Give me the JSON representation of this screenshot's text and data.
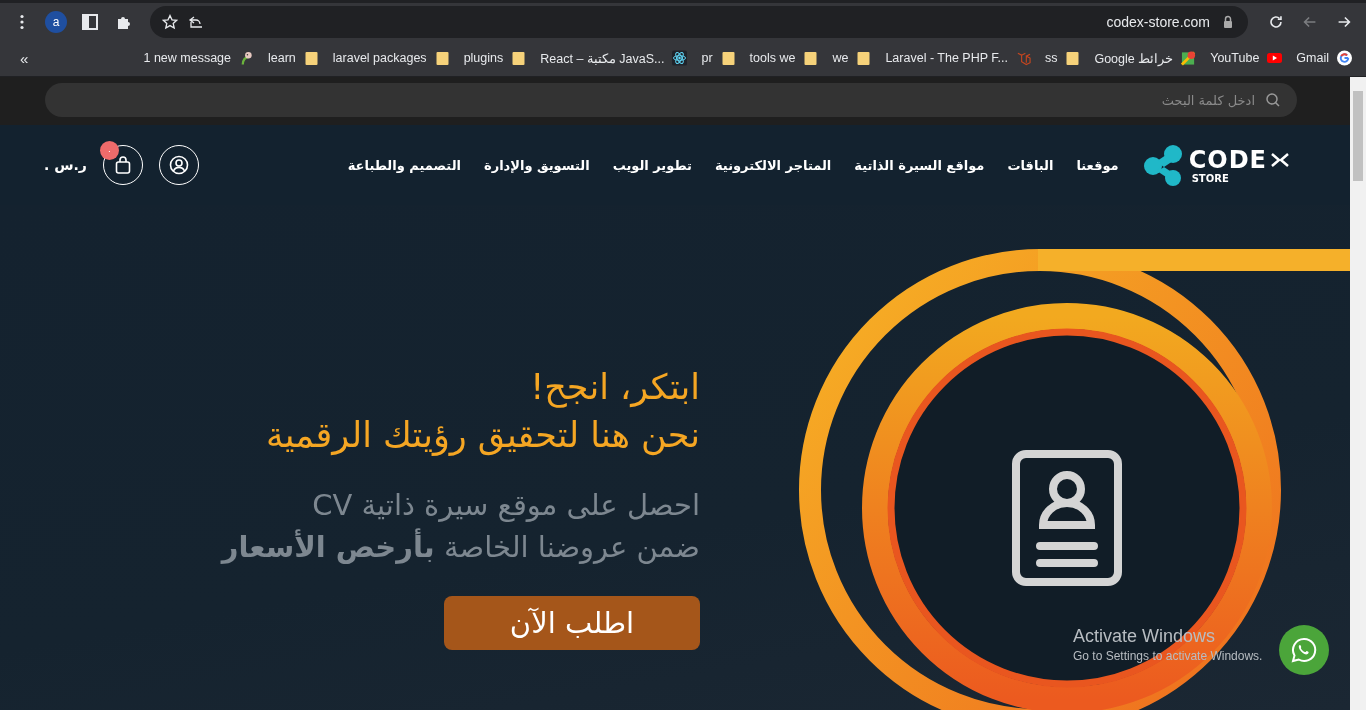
{
  "browser": {
    "account_initial": "a",
    "url": "codex-store.com",
    "nav_buttons": [
      {
        "kind": "reload",
        "disabled": false
      },
      {
        "kind": "back",
        "disabled": true
      },
      {
        "kind": "forward",
        "disabled": false
      }
    ],
    "bookmarks": [
      {
        "label": "Gmail",
        "kind": "google"
      },
      {
        "label": "YouTube",
        "kind": "youtube"
      },
      {
        "label": "Google خرائط",
        "kind": "maps"
      },
      {
        "label": "ss",
        "kind": "folder"
      },
      {
        "label": "Laravel - The PHP F...",
        "kind": "laravel"
      },
      {
        "label": "we",
        "kind": "folder"
      },
      {
        "label": "tools we",
        "kind": "folder"
      },
      {
        "label": "pr",
        "kind": "folder"
      },
      {
        "label": "React – مكتبة JavaS...",
        "kind": "react"
      },
      {
        "label": "plugins",
        "kind": "folder"
      },
      {
        "label": "laravel packages",
        "kind": "folder"
      },
      {
        "label": "learn",
        "kind": "folder"
      },
      {
        "label": "1 new message",
        "kind": "mascot"
      }
    ],
    "overflow": "«"
  },
  "search": {
    "placeholder": "ادخل كلمة البحث"
  },
  "header": {
    "logo_text": "CODE",
    "logo_subtext": "STORE",
    "nav_items": [
      "موقعنا",
      "الباقات",
      "مواقع السيرة الذاتية",
      "المتاجر الالكترونية",
      "تطوير الويب",
      "التسويق والإدارة",
      "التصميم والطباعة"
    ],
    "cart_count": "٠",
    "cart_total": "ر.س ."
  },
  "hero": {
    "headline": [
      "ابتكر، انجح!",
      "نحن هنا لتحقيق رؤيتك الرقمية"
    ],
    "subtitle": [
      "احصل على موقع سيرة ذاتية CV",
      "ضمن عروضنا الخاصة **بأرخص الأسعار**"
    ],
    "cta": "اطلب الآن"
  },
  "os_notice": {
    "title": "Activate Windows",
    "text": "Go to Settings to activate Windows."
  }
}
